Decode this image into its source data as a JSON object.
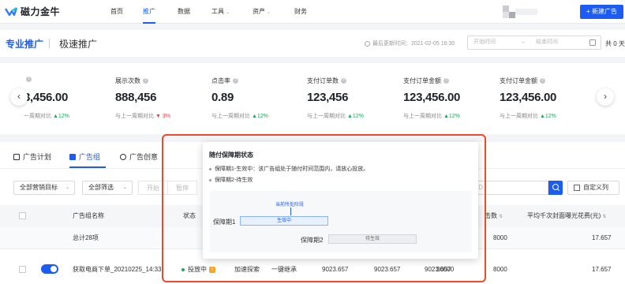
{
  "app": {
    "name": "磁力金牛"
  },
  "nav": {
    "items": [
      "首页",
      "推广",
      "数据",
      "工具",
      "资产",
      "财务"
    ],
    "new_ad": "+ 新建广告"
  },
  "subhead": {
    "tab_pro": "专业推广",
    "tab_fast": "极速推广",
    "update_time": "最后更新时间：2021-02-05 16:30",
    "date_start": "开始时间",
    "date_arrow": "→",
    "date_end": "结束时间",
    "days": "共 0 天"
  },
  "stats": [
    {
      "label": "",
      "value": "3,456.00",
      "compare": "一周期对比",
      "delta": "▲12%",
      "dir": "up"
    },
    {
      "label": "展示次数",
      "value": "888,456",
      "compare": "与上一周期对比",
      "delta": "▼ 3%",
      "dir": "down"
    },
    {
      "label": "点击率",
      "value": "0.89",
      "compare": "与上一周期对比",
      "delta": "▲12%",
      "dir": "up"
    },
    {
      "label": "支付订单数",
      "value": "123,456",
      "compare": "与上一周期对比",
      "delta": "▲12%",
      "dir": "up"
    },
    {
      "label": "支付订单金额",
      "value": "123,456.00",
      "compare": "与上一周期对比",
      "delta": "▲12%",
      "dir": "up"
    },
    {
      "label": "支付订单金额",
      "value": "123,456.00",
      "compare": "与上一周期对比",
      "delta": "▲12%",
      "dir": "up"
    }
  ],
  "panel_tabs": [
    "广告计划",
    "广告组",
    "广告创意"
  ],
  "filters": {
    "marketing": "全部营销目标",
    "filter": "全部筛选",
    "start": "开始",
    "pause": "暂停",
    "search_placeholder": "ID",
    "custom_cols": "自定义列"
  },
  "table": {
    "headers": [
      "广告组名称",
      "状态",
      "击数",
      "平均千次封面曝光花费(元)"
    ],
    "total_label": "总计28项",
    "total_values": [
      "8000",
      "17.657"
    ],
    "row": {
      "name": "获取电商下单_20210225_14:33",
      "status": "投放中",
      "bid": "加速探索",
      "type": "一键继承",
      "c1": "9023.657",
      "c2": "9023.657",
      "c3": "9023.657",
      "c4": "30000",
      "c5": "8000",
      "c6": "17.657"
    }
  },
  "popover": {
    "title": "随付保障期状态",
    "line1": "保障期1-生效中：该广告组处于随付时间范围内，请放心投放。",
    "line2": "保障期2-待生效",
    "current_stage": "当前所处阶段",
    "p1_label": "保障期1",
    "p1_status": "生效中",
    "p2_label": "保障期2",
    "p2_status": "待生效"
  },
  "colors": {
    "accent": "#1d5cf2",
    "up": "#21a85b",
    "down": "#f03e3e",
    "highlight": "#f04a2a"
  }
}
